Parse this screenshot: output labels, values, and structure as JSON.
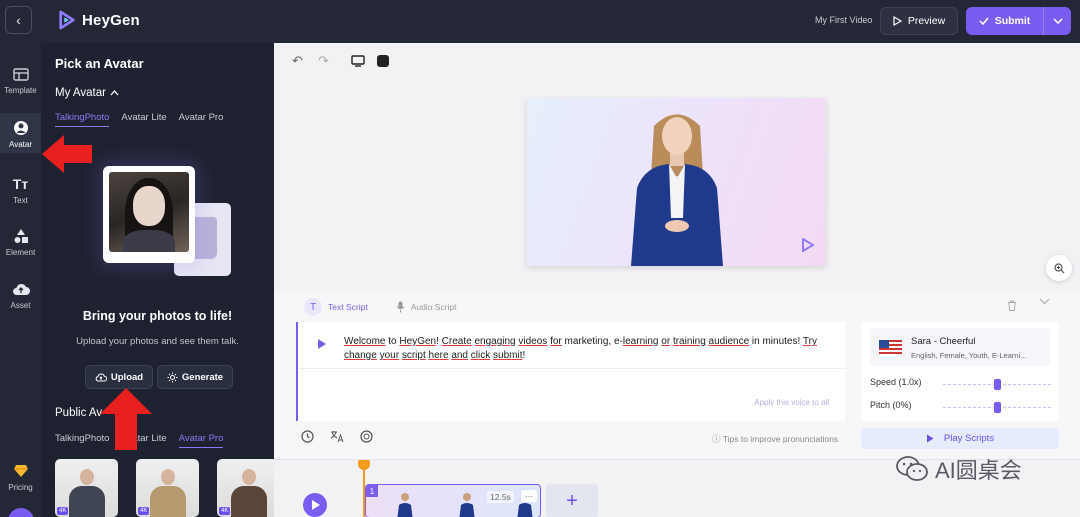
{
  "header": {
    "brand": "HeyGen",
    "video_title": "My First Video",
    "preview_label": "Preview",
    "submit_label": "Submit"
  },
  "rail": {
    "items": [
      {
        "label": "Template"
      },
      {
        "label": "Avatar"
      },
      {
        "label": "Text"
      },
      {
        "label": "Element"
      },
      {
        "label": "Asset"
      },
      {
        "label": "Pricing"
      }
    ]
  },
  "panel": {
    "title": "Pick an Avatar",
    "my_avatar_label": "My Avatar",
    "my_tabs": [
      {
        "label": "TalkingPhoto",
        "active": true
      },
      {
        "label": "Avatar Lite",
        "active": false
      },
      {
        "label": "Avatar Pro",
        "active": false
      }
    ],
    "bring_title": "Bring your photos to life!",
    "bring_sub": "Upload your photos and see them talk.",
    "upload_label": "Upload",
    "generate_label": "Generate",
    "public_label": "Public Av",
    "public_tabs": [
      {
        "label": "TalkingPhoto",
        "active": false
      },
      {
        "label": "Avatar Lite",
        "active": false
      },
      {
        "label": "Avatar Pro",
        "active": true
      }
    ],
    "thumb_badge": "4K"
  },
  "script": {
    "tabs": [
      {
        "label": "Text Script",
        "active": true
      },
      {
        "label": "Audio Script",
        "active": false
      }
    ],
    "text_parts": [
      {
        "t": "Welcome",
        "u": true
      },
      {
        "t": " to ",
        "u": false
      },
      {
        "t": "HeyGen",
        "u": true
      },
      {
        "t": "! ",
        "u": false
      },
      {
        "t": "Create",
        "u": true
      },
      {
        "t": " ",
        "u": false
      },
      {
        "t": "engaging",
        "u": true
      },
      {
        "t": " ",
        "u": false
      },
      {
        "t": "videos",
        "u": true
      },
      {
        "t": " ",
        "u": false
      },
      {
        "t": "for",
        "u": true
      },
      {
        "t": " marketing, e-",
        "u": false
      },
      {
        "t": "learning",
        "u": true
      },
      {
        "t": " ",
        "u": false
      },
      {
        "t": "or",
        "u": true
      },
      {
        "t": " ",
        "u": false
      },
      {
        "t": "training",
        "u": true
      },
      {
        "t": " ",
        "u": false
      },
      {
        "t": "audience",
        "u": true
      },
      {
        "t": " in minutes! ",
        "u": false
      },
      {
        "t": "Try",
        "u": true
      },
      {
        "t": " ",
        "u": false
      },
      {
        "t": "change",
        "u": true
      },
      {
        "t": " ",
        "u": false
      },
      {
        "t": "your",
        "u": true
      },
      {
        "t": " ",
        "u": false
      },
      {
        "t": "script",
        "u": true
      },
      {
        "t": " ",
        "u": false
      },
      {
        "t": "here",
        "u": true
      },
      {
        "t": " ",
        "u": false
      },
      {
        "t": "and",
        "u": true
      },
      {
        "t": " ",
        "u": false
      },
      {
        "t": "click",
        "u": true
      },
      {
        "t": " ",
        "u": false
      },
      {
        "t": "submit",
        "u": true
      },
      {
        "t": "!",
        "u": false
      }
    ],
    "apply_voice": "Apply this voice to all",
    "tips": "Tips to improve pronunciations",
    "voice_name": "Sara - Cheerful",
    "voice_desc": "English, Female, Youth, E-Learni...",
    "speed_label": "Speed (1.0x)",
    "speed_value": 0.5,
    "pitch_label": "Pitch (0%)",
    "pitch_value": 0.5,
    "play_scripts": "Play Scripts"
  },
  "timeline": {
    "clip_number": "1",
    "clip_duration": "12.5s",
    "clip_more": "···",
    "add_symbol": "+"
  },
  "watermark": {
    "text": "AI圆桌会"
  },
  "colors": {
    "accent": "#7b5cf0",
    "dark_bg": "#232736",
    "annotation_arrow": "#e82020"
  },
  "icons": {
    "back": "chevron-left-icon",
    "preview": "play-outline-icon",
    "submit": "check-icon",
    "upload": "cloud-upload-icon",
    "generate": "sparkle-icon"
  }
}
